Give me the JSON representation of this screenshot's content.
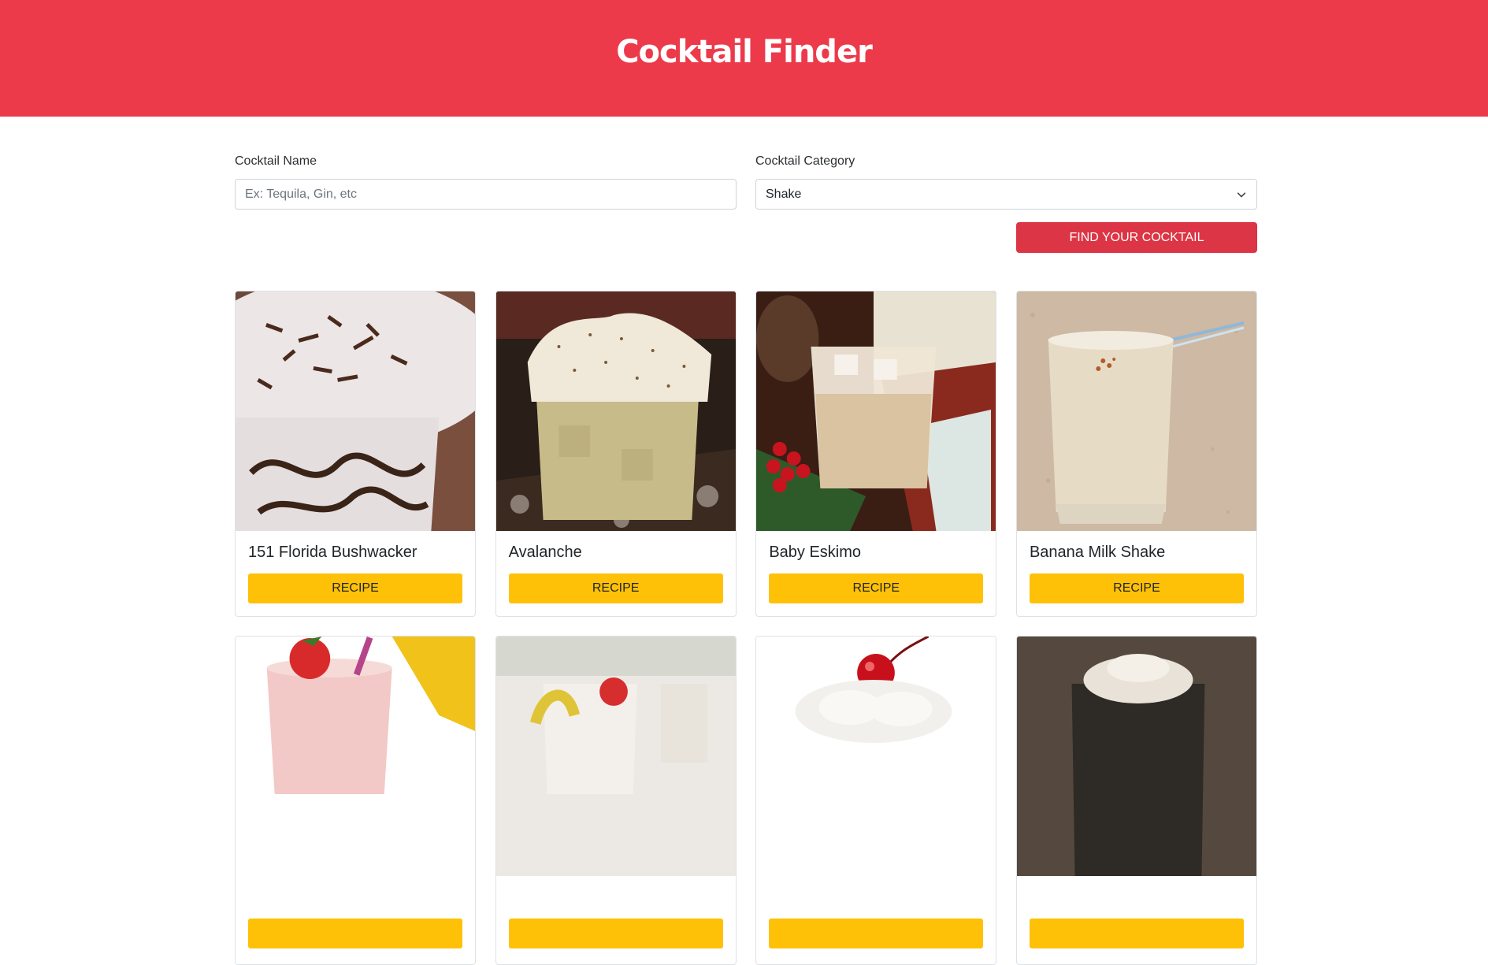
{
  "header": {
    "title": "Cocktail Finder"
  },
  "form": {
    "name_label": "Cocktail Name",
    "name_placeholder": "Ex: Tequila, Gin, etc",
    "category_label": "Cocktail Category",
    "category_value": "Shake",
    "submit_label": "FIND YOUR COCKTAIL"
  },
  "cocktails": [
    {
      "name": "151 Florida Bushwacker",
      "button": "RECIPE"
    },
    {
      "name": "Avalanche",
      "button": "RECIPE"
    },
    {
      "name": "Baby Eskimo",
      "button": "RECIPE"
    },
    {
      "name": "Banana Milk Shake",
      "button": "RECIPE"
    },
    {
      "name": "",
      "button": ""
    },
    {
      "name": "",
      "button": ""
    },
    {
      "name": "",
      "button": ""
    },
    {
      "name": "",
      "button": ""
    }
  ],
  "colors": {
    "header_bg": "#ec3a4b",
    "find_button": "#dc3545",
    "recipe_button": "#ffc107"
  }
}
